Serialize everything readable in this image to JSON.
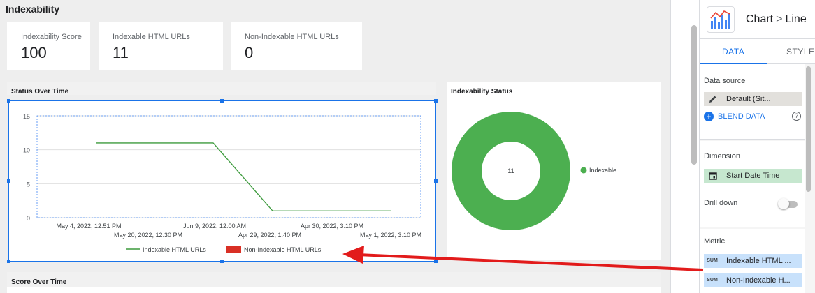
{
  "page": {
    "title": "Indexability"
  },
  "scorecards": [
    {
      "label": "Indexability Score",
      "value": "100"
    },
    {
      "label": "Indexable HTML URLs",
      "value": "11"
    },
    {
      "label": "Non-Indexable HTML URLs",
      "value": "0"
    }
  ],
  "status_over_time": {
    "title": "Status Over Time",
    "legend": [
      "Indexable HTML URLs",
      "Non-Indexable HTML URLs"
    ]
  },
  "indexability_status": {
    "title": "Indexability Status",
    "center_value": "11",
    "legend": "Indexable"
  },
  "score_over_time": {
    "title": "Score Over Time"
  },
  "chart_data": [
    {
      "type": "line",
      "title": "Status Over Time",
      "x_tick_labels_row1": [
        "May 4, 2022, 12:51 PM",
        "Jun 9, 2022, 12:00 AM",
        "Apr 30, 2022, 3:10 PM"
      ],
      "x_tick_labels_row2": [
        "May 20, 2022, 12:30 PM",
        "Apr 29, 2022, 1:40 PM",
        "May 1, 2022, 3:10 PM"
      ],
      "y_ticks": [
        "0",
        "5",
        "10",
        "15"
      ],
      "ylim": [
        0,
        15
      ],
      "series": [
        {
          "name": "Indexable HTML URLs",
          "color": "#3c9a3c",
          "x": [
            0,
            1,
            2,
            3
          ],
          "values": [
            11,
            11,
            1,
            1
          ]
        },
        {
          "name": "Non-Indexable HTML URLs",
          "color": "#d93025",
          "x": [],
          "values": []
        }
      ],
      "legend_position": "bottom"
    },
    {
      "type": "pie",
      "title": "Indexability Status",
      "slices": [
        {
          "name": "Indexable",
          "value": 11,
          "color": "#4caf50"
        }
      ],
      "legend_position": "right"
    }
  ],
  "side_panel": {
    "breadcrumb_root": "Chart",
    "breadcrumb_sep": ">",
    "breadcrumb_leaf": "Line",
    "tab_data": "DATA",
    "tab_style": "STYLE",
    "data_source_title": "Data source",
    "data_source_value": "Default (Sit...",
    "blend_label": "BLEND DATA",
    "help_glyph": "?",
    "dimension_title": "Dimension",
    "dimension_value": "Start Date Time",
    "drill_down_label": "Drill down",
    "metric_title": "Metric",
    "metric_agg": "SUM",
    "metrics": [
      "Indexable HTML ...",
      "Non-Indexable H..."
    ]
  },
  "colors": {
    "accent": "#1a73e8",
    "indexable": "#4caf50",
    "non_indexable": "#d93025",
    "annotation_arrow": "#e21b1b"
  }
}
